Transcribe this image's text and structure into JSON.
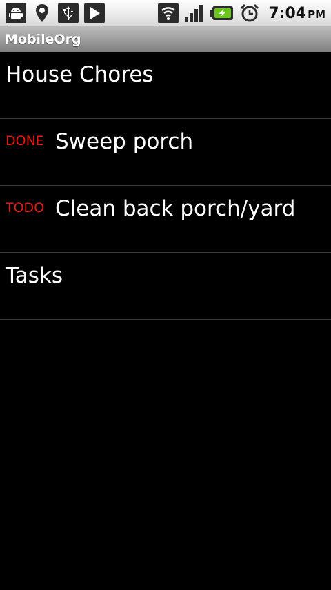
{
  "status_bar": {
    "icons_left": [
      "android-debug-icon",
      "location-pin-icon",
      "usb-icon",
      "play-icon"
    ],
    "icons_right": [
      "wifi-icon",
      "signal-icon",
      "battery-charging-icon",
      "alarm-clock-icon"
    ],
    "time": "7:04",
    "ampm": "PM"
  },
  "app": {
    "title": "MobileOrg"
  },
  "outline": {
    "items": [
      {
        "keyword": "",
        "heading": "House Chores"
      },
      {
        "keyword": "DONE",
        "heading": "Sweep porch"
      },
      {
        "keyword": "TODO",
        "heading": "Clean back porch/yard"
      },
      {
        "keyword": "",
        "heading": "Tasks"
      }
    ]
  },
  "colors": {
    "keyword": "#e8170f",
    "background": "#000000",
    "heading": "#ffffff"
  }
}
